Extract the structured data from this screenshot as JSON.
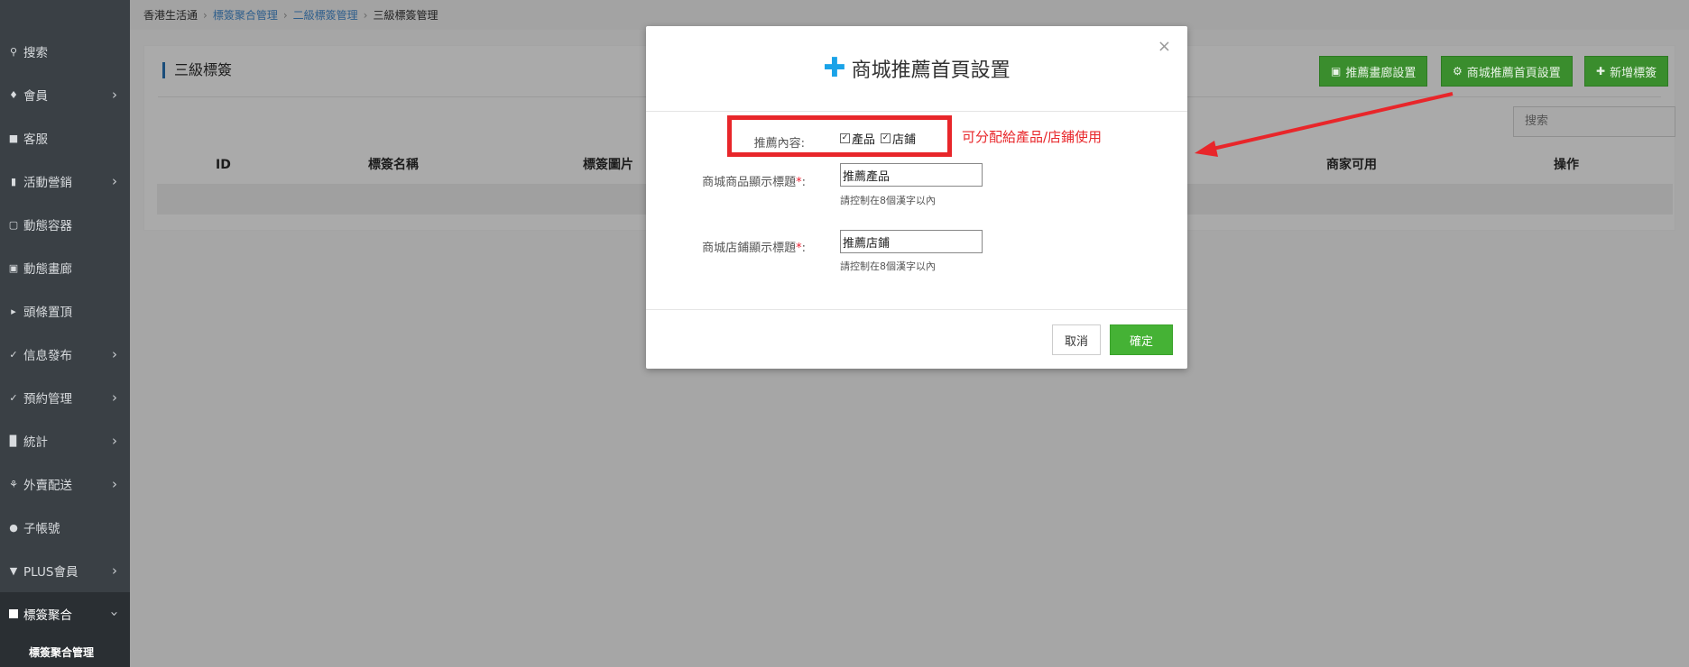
{
  "sidebar": {
    "items": [
      {
        "label": "搜索",
        "icon": "search-icon",
        "chevron": false
      },
      {
        "label": "會員",
        "icon": "bell-icon",
        "chevron": true
      },
      {
        "label": "客服",
        "icon": "chat-icon",
        "chevron": false
      },
      {
        "label": "活動營銷",
        "icon": "bookmark-icon",
        "chevron": true
      },
      {
        "label": "動態容器",
        "icon": "box-icon",
        "chevron": false
      },
      {
        "label": "動態畫廊",
        "icon": "image-icon",
        "chevron": false
      },
      {
        "label": "頭條置頂",
        "icon": "megaphone-icon",
        "chevron": false
      },
      {
        "label": "信息發布",
        "icon": "check-icon",
        "chevron": true
      },
      {
        "label": "預約管理",
        "icon": "check-icon",
        "chevron": true
      },
      {
        "label": "統計",
        "icon": "bar-chart-icon",
        "chevron": true
      },
      {
        "label": "外賣配送",
        "icon": "utensils-icon",
        "chevron": true
      },
      {
        "label": "子帳號",
        "icon": "user-icon",
        "chevron": false
      },
      {
        "label": "PLUS會員",
        "icon": "wifi-icon",
        "chevron": true
      },
      {
        "label": "標簽聚合",
        "icon": "square-icon",
        "chevron": true
      }
    ],
    "submenu_label": "標簽聚合管理"
  },
  "breadcrumb": {
    "home": "香港生活通",
    "level1": "標簽聚合管理",
    "level2": "二級標簽管理",
    "current": "三級標簽管理"
  },
  "panel": {
    "title": "三級標簽",
    "buttons": {
      "gallery": "推薦畫廊設置",
      "mall_home": "商城推薦首頁設置",
      "add_tag": "新增標簽"
    },
    "search_placeholder": "搜索",
    "columns": {
      "id": "ID",
      "name": "標簽名稱",
      "image": "標簽圖片",
      "merchant": "商家可用",
      "action": "操作"
    }
  },
  "modal": {
    "title": "商城推薦首頁設置",
    "content_label": "推薦內容:",
    "option_product": "產品",
    "option_store": "店鋪",
    "product_title_label": "商城商品顯示標題",
    "product_title_value": "推薦產品",
    "product_hint": "請控制在8個漢字以內",
    "store_title_label": "商城店鋪顯示標題",
    "store_title_value": "推薦店鋪",
    "store_hint": "請控制在8個漢字以內",
    "required_mark": "*",
    "colon": ":",
    "cancel": "取消",
    "confirm": "確定",
    "close": "×"
  },
  "annotation": {
    "text": "可分配給產品/店鋪使用",
    "color": "#e8262a"
  },
  "colors": {
    "sidebar_bg": "#3a4045",
    "green_button": "#45b235",
    "accent_blue": "#1aa3e8"
  }
}
